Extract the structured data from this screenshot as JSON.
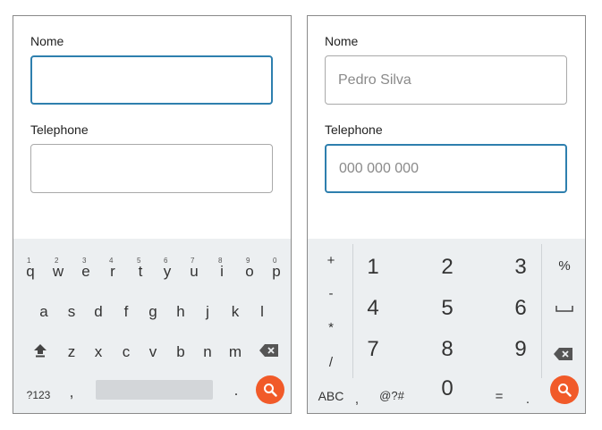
{
  "left_screen": {
    "name_label": "Nome",
    "name_value": "",
    "phone_label": "Telephone",
    "phone_value": "",
    "keyboard": {
      "row1": [
        "q",
        "w",
        "e",
        "r",
        "t",
        "y",
        "u",
        "i",
        "o",
        "p"
      ],
      "row1_hints": [
        "1",
        "2",
        "3",
        "4",
        "5",
        "6",
        "7",
        "8",
        "9",
        "0"
      ],
      "row2": [
        "a",
        "s",
        "d",
        "f",
        "g",
        "h",
        "j",
        "k",
        "l"
      ],
      "row3": [
        "z",
        "x",
        "c",
        "v",
        "b",
        "n",
        "m"
      ],
      "symbols_key": "?123",
      "comma_key": ",",
      "period_key": "."
    }
  },
  "right_screen": {
    "name_label": "Nome",
    "name_value": "Pedro Silva",
    "phone_label": "Telephone",
    "phone_placeholder": "000 000 000",
    "numpad": {
      "left_col": [
        "+",
        "-",
        "*",
        "/"
      ],
      "digits": [
        "1",
        "2",
        "3",
        "4",
        "5",
        "6",
        "7",
        "8",
        "9"
      ],
      "zero": "0",
      "right_col": [
        "%"
      ],
      "abc_key": "ABC",
      "comma_key": ",",
      "symbols_key": "@?#",
      "equals_key": "=",
      "period_key": "."
    }
  },
  "colors": {
    "focus_border": "#2e7fae",
    "search_button": "#f15a29",
    "keyboard_bg": "#eceff1"
  },
  "icons": [
    "shift-icon",
    "backspace-icon",
    "search-icon",
    "space-icon"
  ]
}
